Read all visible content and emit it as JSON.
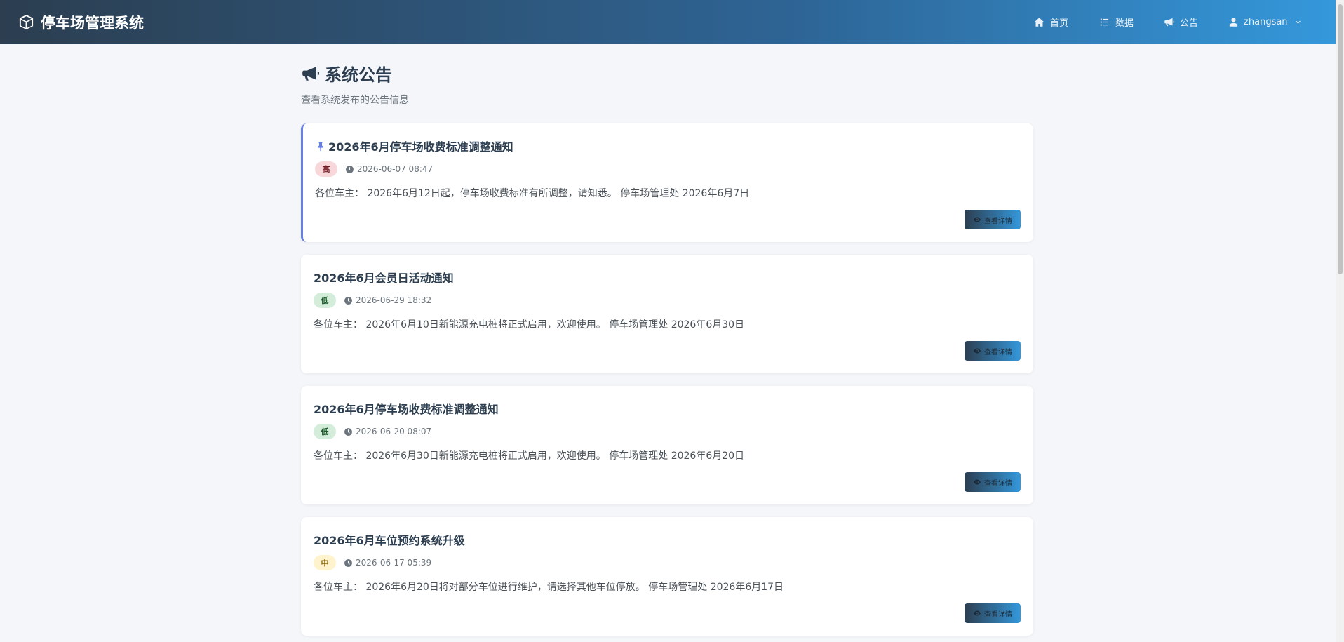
{
  "app": {
    "brand_name": "停车场管理系统",
    "brand_icon": "cube-icon"
  },
  "nav": {
    "home": "首页",
    "data": "数据",
    "notice": "公告",
    "user": "zhangsan"
  },
  "page": {
    "title": "系统公告",
    "subtitle": "查看系统发布的公告信息"
  },
  "detail_label": "查看详情",
  "announcements": [
    {
      "title": "2026年6月停车场收费标准调整通知",
      "pinned": true,
      "priority": "高",
      "priority_level": "high",
      "time": "2026-06-07 08:47",
      "content": "各位车主： 2026年6月12日起，停车场收费标准有所调整，请知悉。 停车场管理处 2026年6月7日"
    },
    {
      "title": "2026年6月会员日活动通知",
      "pinned": false,
      "priority": "低",
      "priority_level": "low",
      "time": "2026-06-29 18:32",
      "content": "各位车主： 2026年6月10日新能源充电桩将正式启用，欢迎使用。 停车场管理处 2026年6月30日"
    },
    {
      "title": "2026年6月停车场收费标准调整通知",
      "pinned": false,
      "priority": "低",
      "priority_level": "low",
      "time": "2026-06-20 08:07",
      "content": "各位车主： 2026年6月30日新能源充电桩将正式启用，欢迎使用。 停车场管理处 2026年6月20日"
    },
    {
      "title": "2026年6月车位预约系统升级",
      "pinned": false,
      "priority": "中",
      "priority_level": "mid",
      "time": "2026-06-17 05:39",
      "content": "各位车主： 2026年6月20日将对部分车位进行维护，请选择其他车位停放。 停车场管理处 2026年6月17日"
    }
  ],
  "colors": {
    "header_start": "#2c3e50",
    "header_end": "#3498db",
    "pin_accent": "#667eea",
    "priority_high_bg": "#f8d7da",
    "priority_low_bg": "#d4edda",
    "priority_mid_bg": "#fff3cd"
  }
}
